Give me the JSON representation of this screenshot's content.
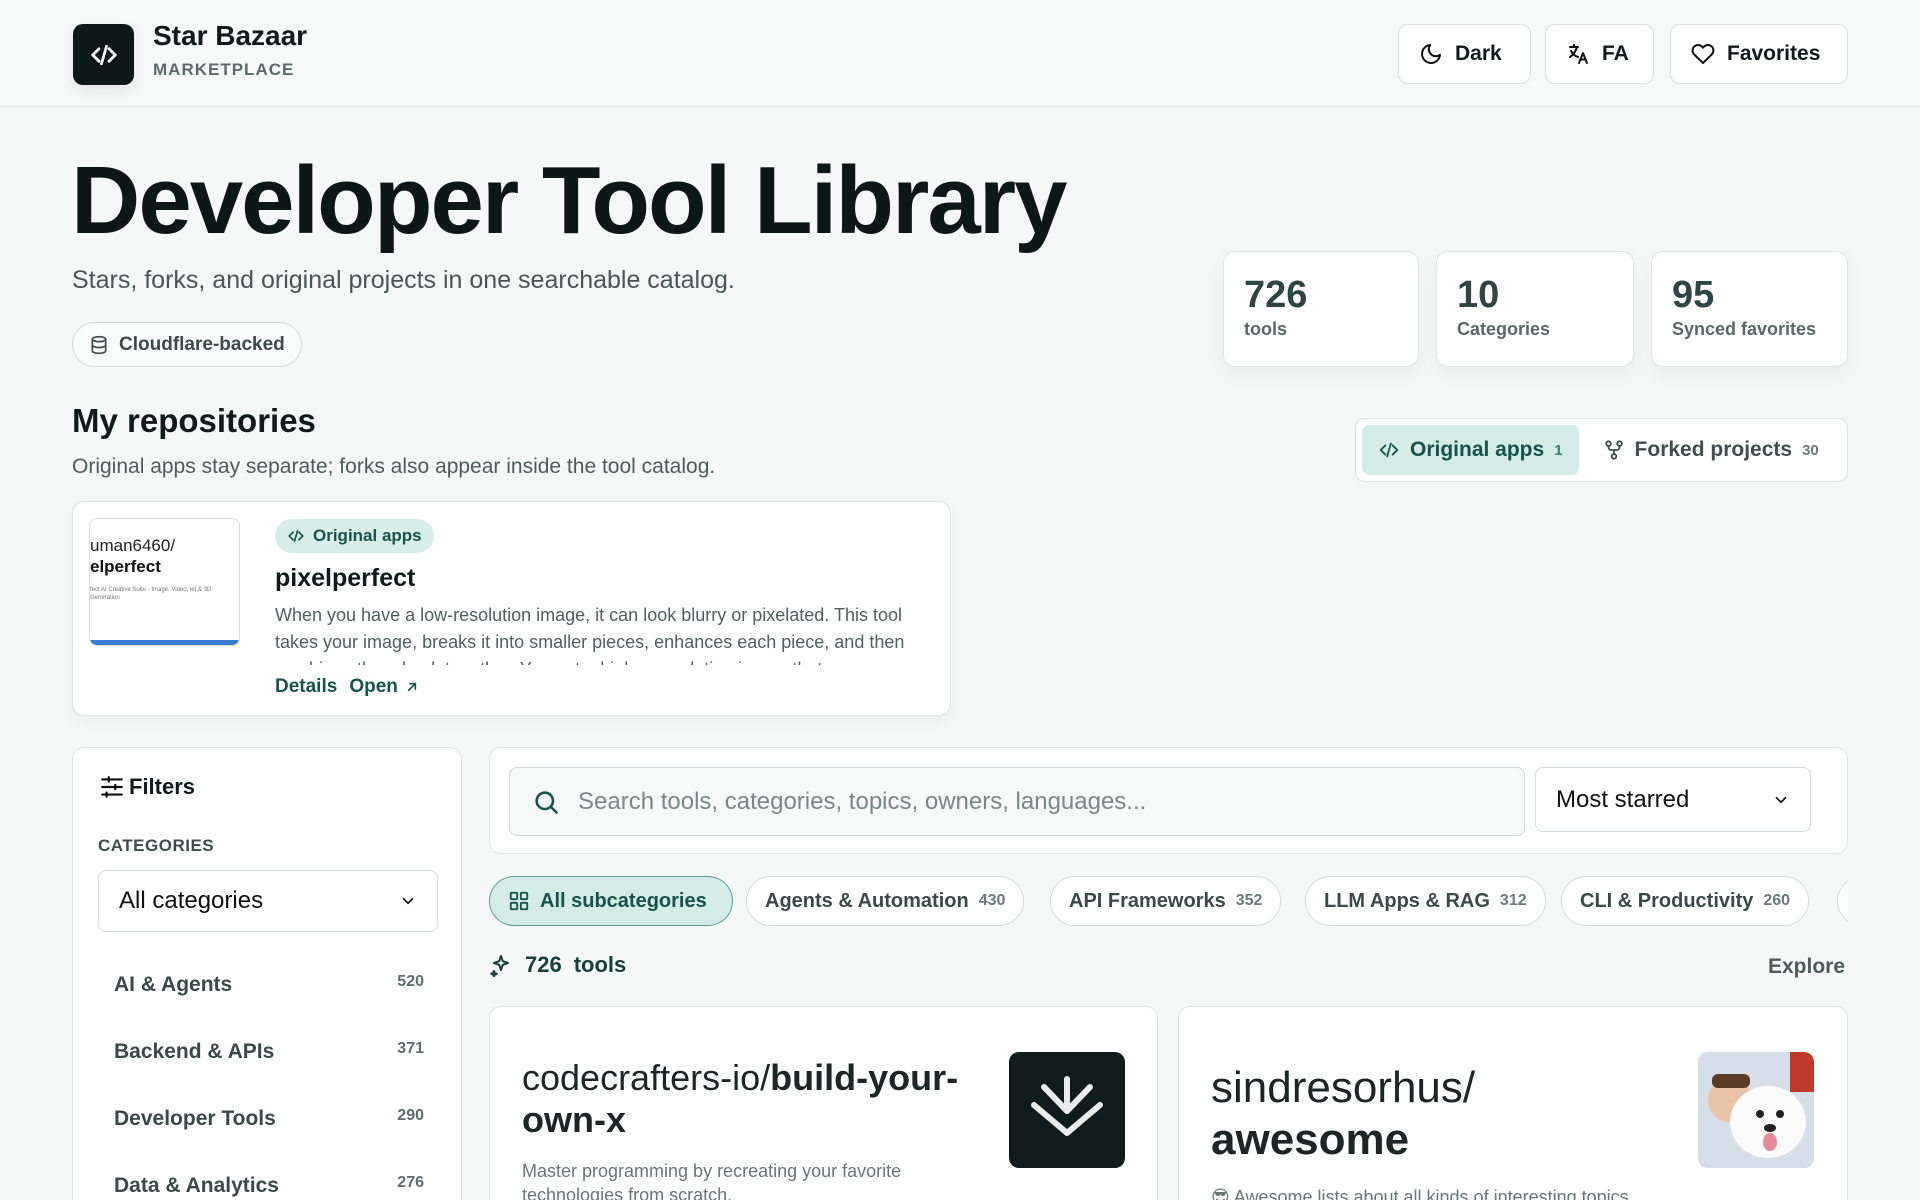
{
  "header": {
    "brand_name": "Star Bazaar",
    "brand_sub": "MARKETPLACE",
    "dark_label": "Dark",
    "lang_label": "FA",
    "favorites_label": "Favorites"
  },
  "hero": {
    "title": "Developer Tool Library",
    "subtitle": "Stars, forks, and original projects in one searchable catalog.",
    "badge": "Cloudflare-backed"
  },
  "stats": [
    {
      "value": "726",
      "label": "tools"
    },
    {
      "value": "10",
      "label": "Categories"
    },
    {
      "value": "95",
      "label": "Synced favorites"
    }
  ],
  "repos": {
    "title": "My repositories",
    "subtitle": "Original apps stay separate; forks also appear inside the tool catalog.",
    "tabs": [
      {
        "label": "Original apps",
        "count": "1",
        "active": true
      },
      {
        "label": "Forked projects",
        "count": "30",
        "active": false
      }
    ],
    "card": {
      "thumb_line1": "uman6460/",
      "thumb_line2": "elperfect",
      "thumb_line3": "fect AI Creative Suite - Image, Video, let & 3D Generation",
      "badge": "Original apps",
      "name": "pixelperfect",
      "description": "When you have a low-resolution image, it can look blurry or pixelated. This tool takes your image, breaks it into smaller pieces, enhances each piece, and then combines them back together. You get a higher resolution image that",
      "details_label": "Details",
      "open_label": "Open"
    }
  },
  "filters": {
    "title": "Filters",
    "categories_label": "CATEGORIES",
    "select_value": "All categories",
    "items": [
      {
        "label": "AI & Agents",
        "count": "520"
      },
      {
        "label": "Backend & APIs",
        "count": "371"
      },
      {
        "label": "Developer Tools",
        "count": "290"
      },
      {
        "label": "Data & Analytics",
        "count": "276"
      }
    ]
  },
  "search": {
    "placeholder": "Search tools, categories, topics, owners, languages...",
    "sort_value": "Most starred"
  },
  "subcategories": [
    {
      "label": "All subcategories",
      "count": "",
      "active": true
    },
    {
      "label": "Agents & Automation",
      "count": "430"
    },
    {
      "label": "API Frameworks",
      "count": "352"
    },
    {
      "label": "LLM Apps & RAG",
      "count": "312"
    },
    {
      "label": "CLI & Productivity",
      "count": "260"
    }
  ],
  "results": {
    "count": "726",
    "unit": "tools",
    "explore_label": "Explore"
  },
  "tools": [
    {
      "owner": "codecrafters-io/",
      "name": "build-your-own-x",
      "description": "Master programming by recreating your favorite technologies from scratch."
    },
    {
      "owner": "sindresorhus/",
      "name": "awesome",
      "description": "😎 Awesome lists about all kinds of interesting topics"
    }
  ],
  "colors": {
    "accent": "#14544c",
    "accent_bg": "#d5ebe7",
    "dark": "#0d1918"
  }
}
